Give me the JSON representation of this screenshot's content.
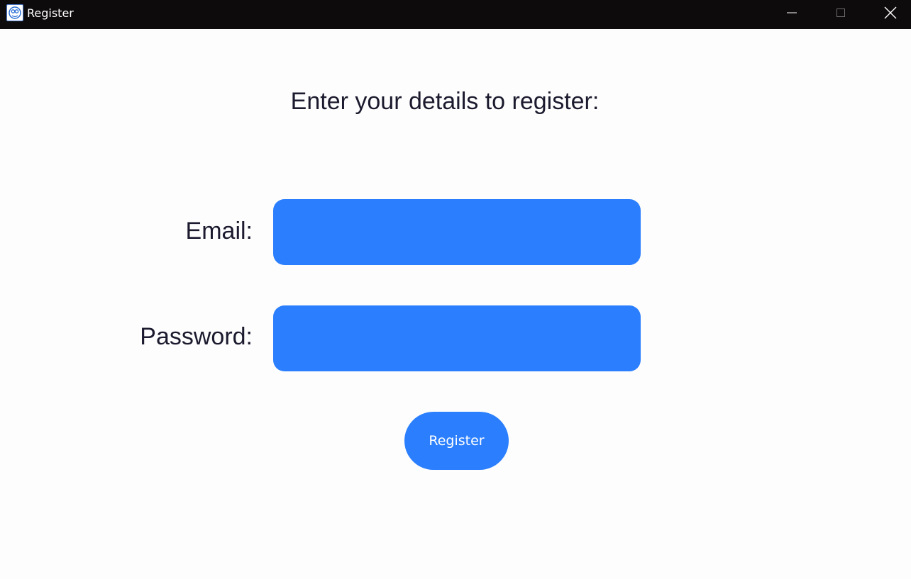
{
  "window": {
    "title": "Register",
    "icon": "app-logo-icon",
    "controls": [
      "minimize-icon",
      "maximize-icon",
      "close-icon"
    ]
  },
  "form": {
    "heading": "Enter your details to register:",
    "email_label": "Email:",
    "email_value": "",
    "password_label": "Password:",
    "password_value": "",
    "submit_label": "Register"
  },
  "colors": {
    "titlebar": "#0e0b0c",
    "background": "#fdfdfd",
    "accent": "#2b7fff",
    "text": "#1b1a2e"
  }
}
